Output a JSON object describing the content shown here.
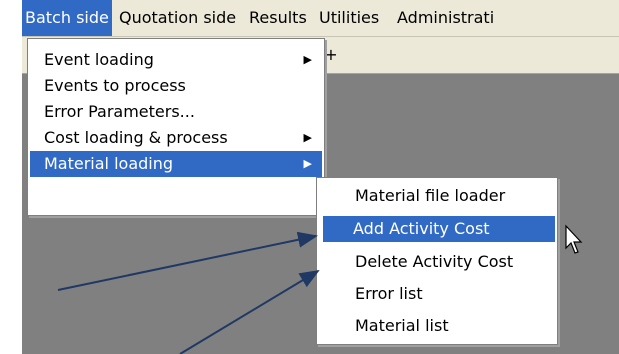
{
  "menubar": {
    "items": [
      "Batch side",
      "Quotation side",
      "Results",
      "Utilities",
      "Administrati"
    ]
  },
  "toolbar": {
    "button_glyph": "+"
  },
  "batch_menu": {
    "items": [
      {
        "label": "Event loading",
        "submenu": true
      },
      {
        "label": "Events to process",
        "submenu": false
      },
      {
        "label": "Error Parameters...",
        "submenu": false
      },
      {
        "label": "Cost loading & process",
        "submenu": true
      },
      {
        "label": "Material loading",
        "submenu": true
      }
    ],
    "highlighted": "Material loading"
  },
  "material_submenu": {
    "items": [
      "Material file loader",
      "Add Activity Cost",
      "Delete Activity Cost",
      "Error list",
      "Material list"
    ],
    "highlighted": "Add Activity Cost"
  },
  "colors": {
    "highlight": "#316ac5",
    "annotation_arrow": "#1f3864",
    "workspace": "#808080"
  }
}
